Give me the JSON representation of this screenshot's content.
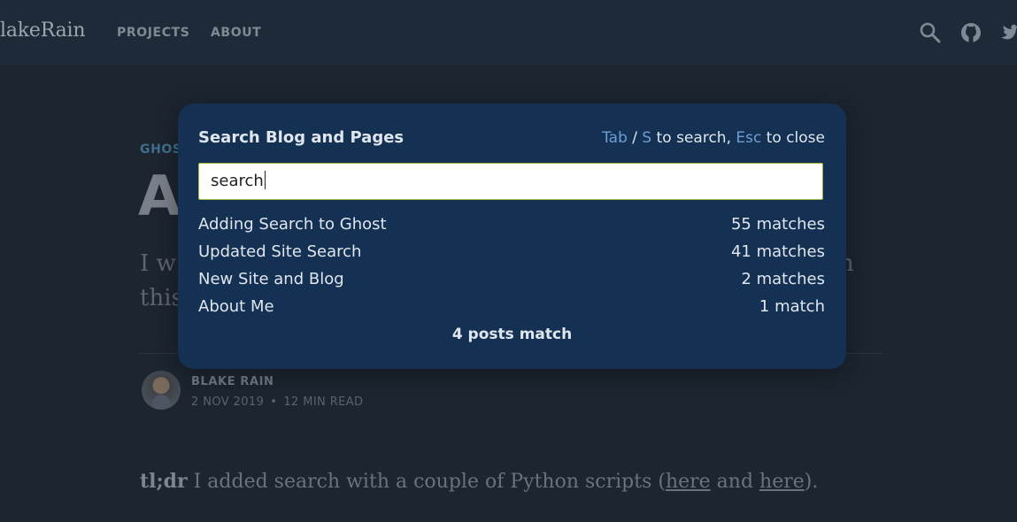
{
  "header": {
    "brand": "lakeRain",
    "nav": [
      "PROJECTS",
      "ABOUT"
    ],
    "icons": [
      "search-icon",
      "github-icon",
      "twitter-icon"
    ]
  },
  "article": {
    "tag": "GHOS",
    "title": "A",
    "excerpt_line1": "I w",
    "excerpt_line1_end": "n",
    "excerpt_line2": "this",
    "author": "BLAKE RAIN",
    "date": "2 NOV 2019",
    "separator": "•",
    "read_time": "12 MIN READ",
    "body_bold": "tl;dr",
    "body_text": " I added search with a couple of Python scripts (",
    "link1": "here",
    "body_and": " and ",
    "link2": "here",
    "body_end": ")."
  },
  "search_modal": {
    "title": "Search Blog and Pages",
    "hint_key1": "Tab",
    "hint_slash": " / ",
    "hint_key2": "S",
    "hint_text1": " to search, ",
    "hint_key3": "Esc",
    "hint_text2": " to close",
    "query": "search",
    "results": [
      {
        "title": "Adding Search to Ghost",
        "count": "55 matches"
      },
      {
        "title": "Updated Site Search",
        "count": "41 matches"
      },
      {
        "title": "New Site and Blog",
        "count": "2 matches"
      },
      {
        "title": "About Me",
        "count": "1 match"
      }
    ],
    "summary": "4 posts match"
  },
  "colors": {
    "modal_bg": "#143052",
    "hint_key": "#6c9fd4",
    "page_bg": "#1c2530"
  }
}
